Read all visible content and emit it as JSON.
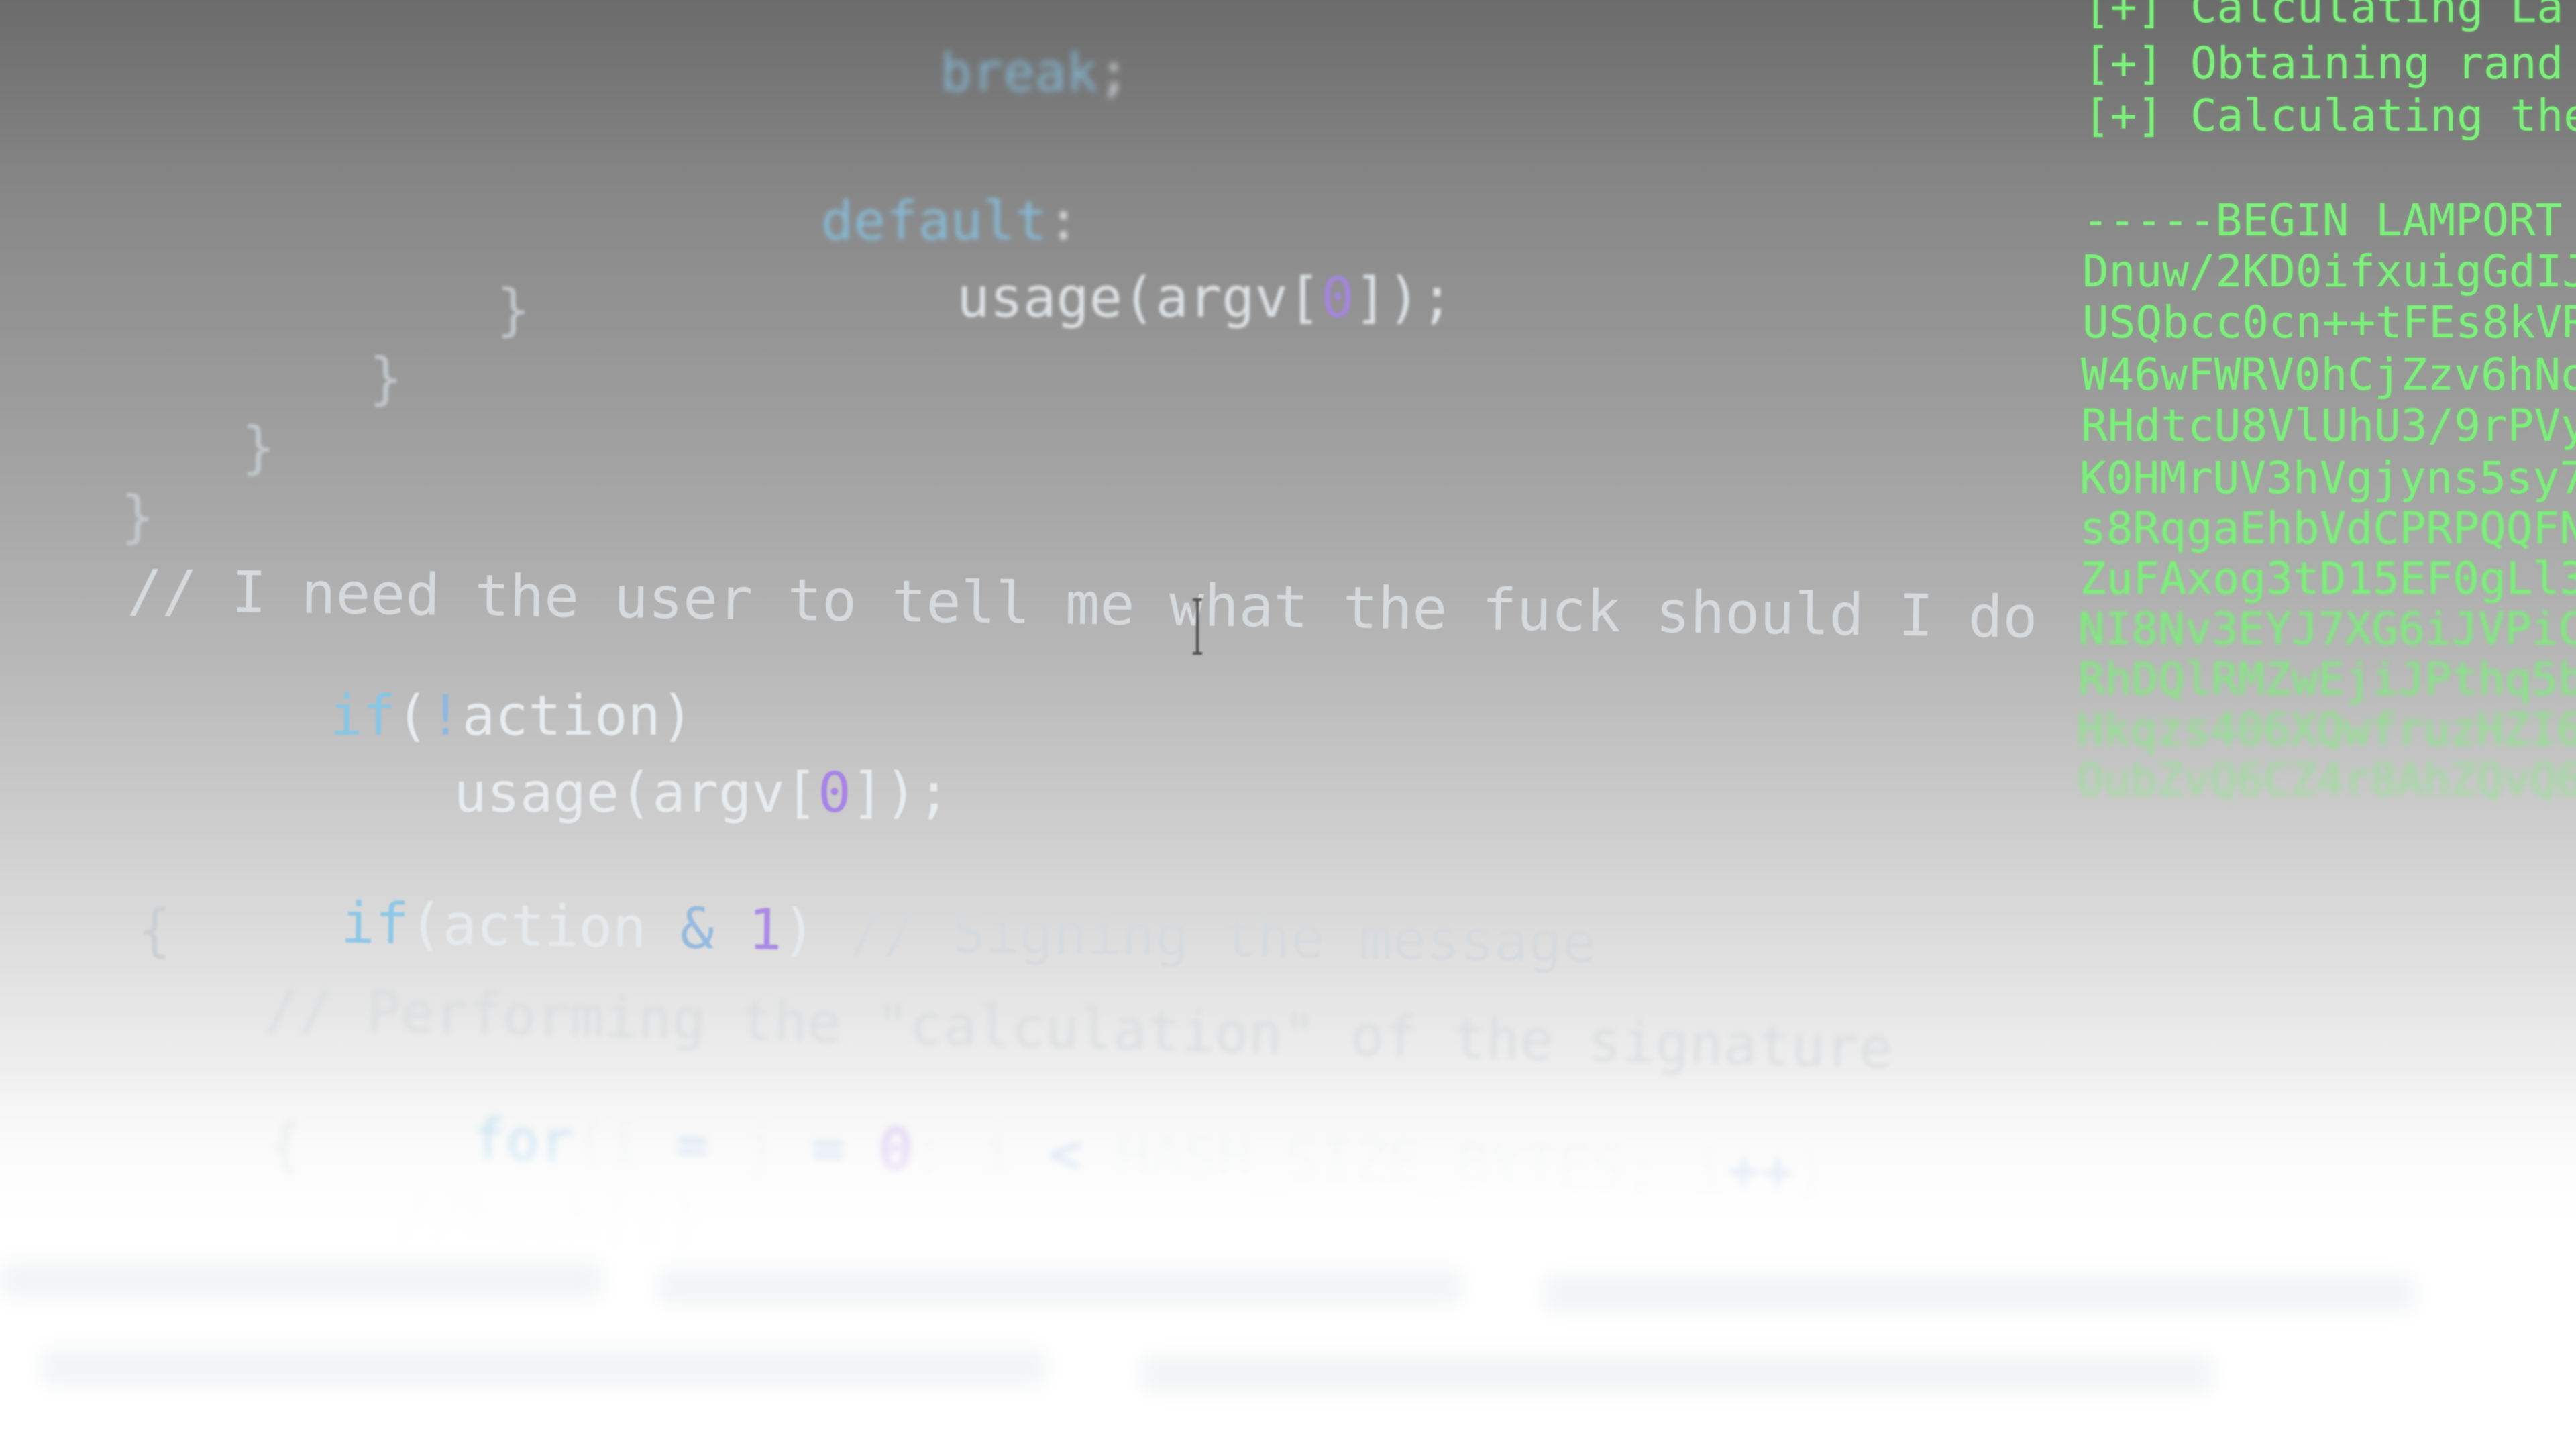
{
  "editor": {
    "lines": {
      "break_stmt": {
        "kw": "break",
        "punct": ";"
      },
      "default_label": {
        "kw": "default",
        "punct": ":"
      },
      "usage_inner": {
        "pre": "usage(argv[",
        "num": "0",
        "post": "]);"
      },
      "brace_1": "}",
      "brace_2": "}",
      "brace_3": "}",
      "brace_4": "}",
      "comment_need": "// I need the user to tell me what the fuck should I do",
      "if_action": {
        "kw": "if",
        "pre": "(",
        "op": "!",
        "post": "action)"
      },
      "usage_outer": {
        "pre": "usage(argv[",
        "num": "0",
        "post": "]);"
      },
      "if_sign": {
        "kw": "if",
        "pre": "(action ",
        "op": "&",
        "num": "1",
        "post": ") ",
        "comment": "// Signing the message"
      },
      "open_brace": "{",
      "comment_perform": "// Performing the \"calculation\" of the signature",
      "for_loop": {
        "kw": "for",
        "pre": "(i ",
        "op1": "=",
        "mid1": " j ",
        "op2": "=",
        "num": "0",
        "mid2": "; i ",
        "op3": "<",
        "mid3": " HASH_SIZE_BYTES; i",
        "op4": "++",
        "post": ")"
      },
      "open_brace_inner": "{",
      "hash_comment": "//hash[i]"
    }
  },
  "terminal": {
    "lines": [
      "[+] Calculating La",
      "[+] Obtaining rand",
      "[+] Calculating the",
      "",
      "-----BEGIN LAMPORT",
      "Dnuw/2KD0ifxuigGdIJ",
      "USQbcc0cn++tFEs8kVR",
      "W46wFWRV0hCjZzv6hNo",
      "RHdtcU8VlUhU3/9rPVy",
      "K0HMrUV3hVgjyns5sy7",
      "s8RqgaEhbVdCPRPQQFN",
      "ZuFAxog3tD15EF0gLl3",
      "NI8Nv3EYJ7XG6iJVPiC",
      "RhDQlRMZwEjiJPthq5b",
      "Hkqzs406XQwfruzHZI6",
      "OubZvQ6CZ4r8AhZQvQ6"
    ]
  },
  "colors": {
    "keyword": "#86c6e6",
    "number": "#a884e8",
    "text": "#e8ecef",
    "terminal_green": "#7cf07a"
  },
  "icons": {
    "cursor": "text-cursor-ibeam-icon"
  }
}
